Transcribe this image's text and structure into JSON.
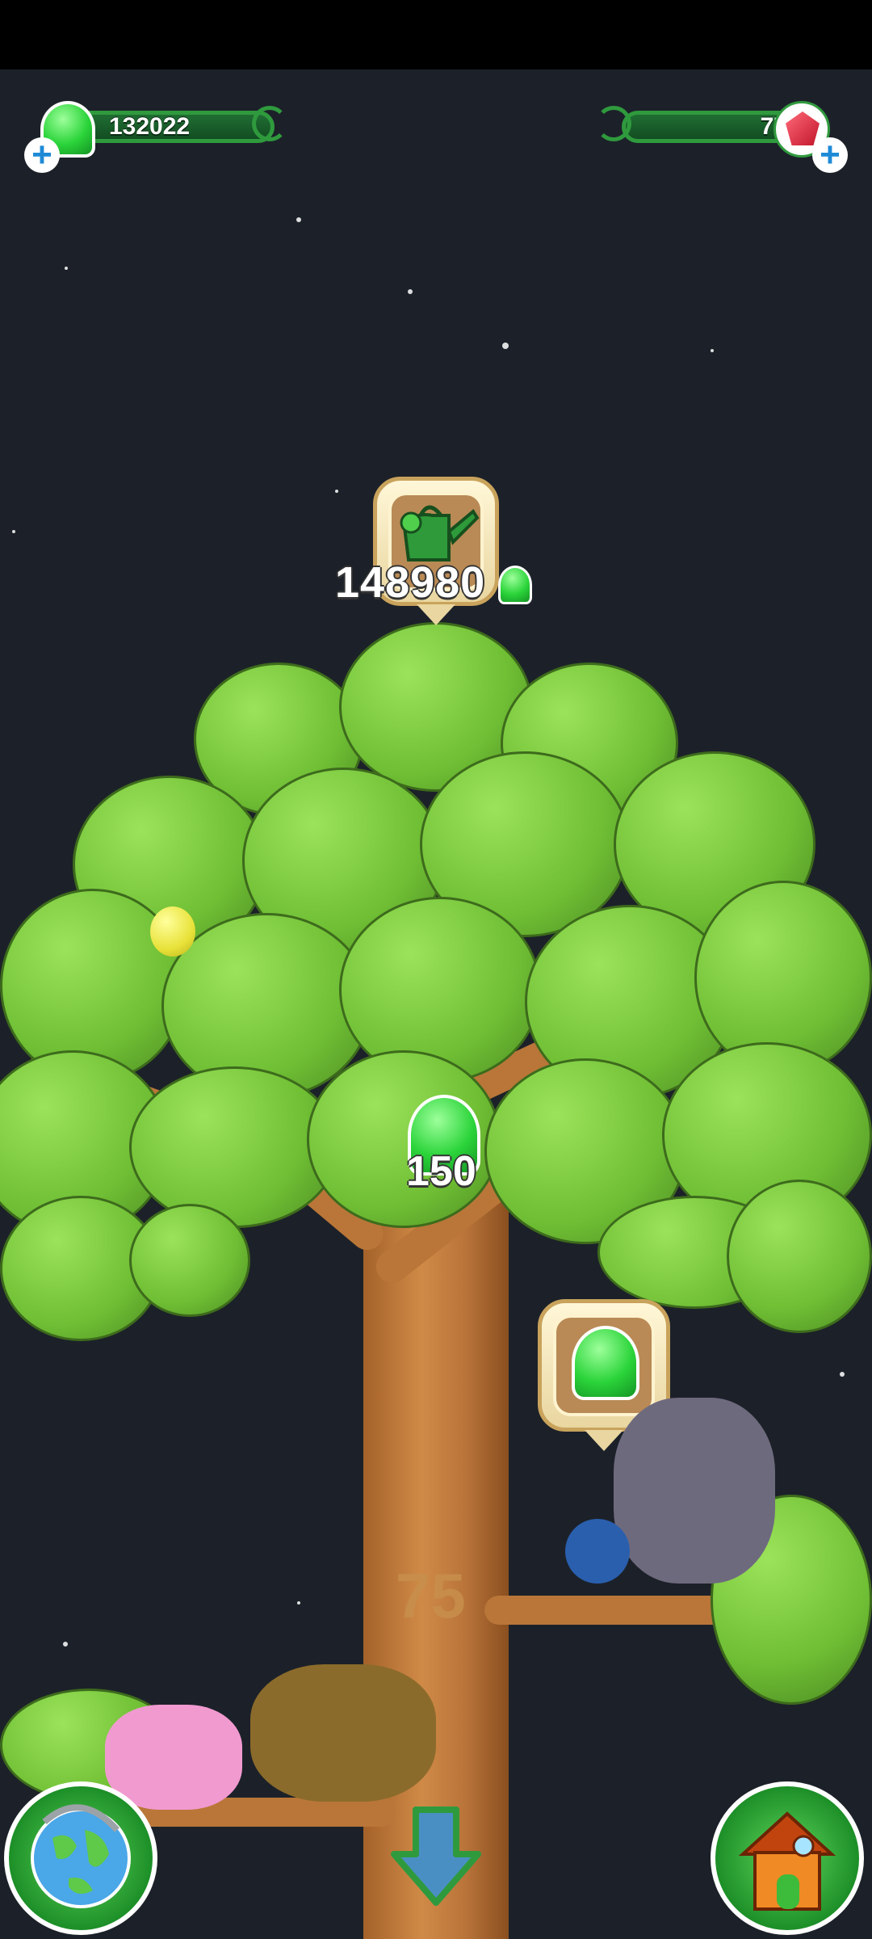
{
  "hud": {
    "gems_value": "132022",
    "rubies_value": "77",
    "gems_icon": "green-gem-icon",
    "rubies_icon": "red-crystal-icon",
    "add_icon": "plus-icon"
  },
  "water_bubble": {
    "icon": "watering-can-icon",
    "cost": "148980",
    "currency_icon": "green-gem-icon"
  },
  "tree_gem": {
    "value": "150"
  },
  "reward_bubble": {
    "icon": "green-gem-icon"
  },
  "tree": {
    "level_label": "75"
  },
  "buttons": {
    "world_icon": "globe-icon",
    "home_icon": "house-icon",
    "scroll_icon": "down-arrow-icon"
  },
  "colors": {
    "sky": "#1c2129",
    "hud_green": "#2f9a3d",
    "leaf": "#6fbe34",
    "trunk": "#b9743a"
  }
}
